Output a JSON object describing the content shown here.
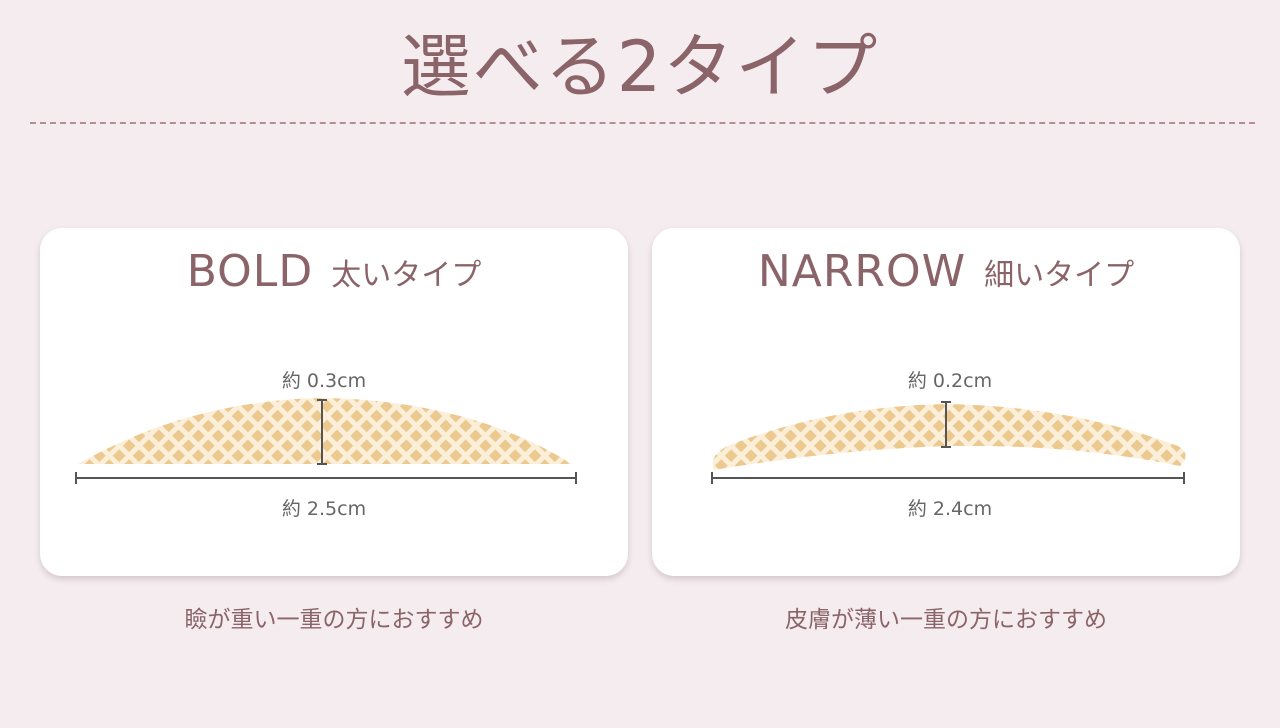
{
  "title": "選べる2タイプ",
  "colors": {
    "background": "#f4ecef",
    "text_accent": "#8a6468",
    "card": "#ffffff",
    "patch_base": "#ecc98f",
    "patch_mesh": "#fbefda"
  },
  "cards": [
    {
      "name_en": "BOLD",
      "name_jp": "太いタイプ",
      "height_label": "約 0.3cm",
      "width_label": "約 2.5cm",
      "caption": "瞼が重い一重の方におすすめ"
    },
    {
      "name_en": "NARROW",
      "name_jp": "細いタイプ",
      "height_label": "約 0.2cm",
      "width_label": "約 2.4cm",
      "caption": "皮膚が薄い一重の方におすすめ"
    }
  ]
}
